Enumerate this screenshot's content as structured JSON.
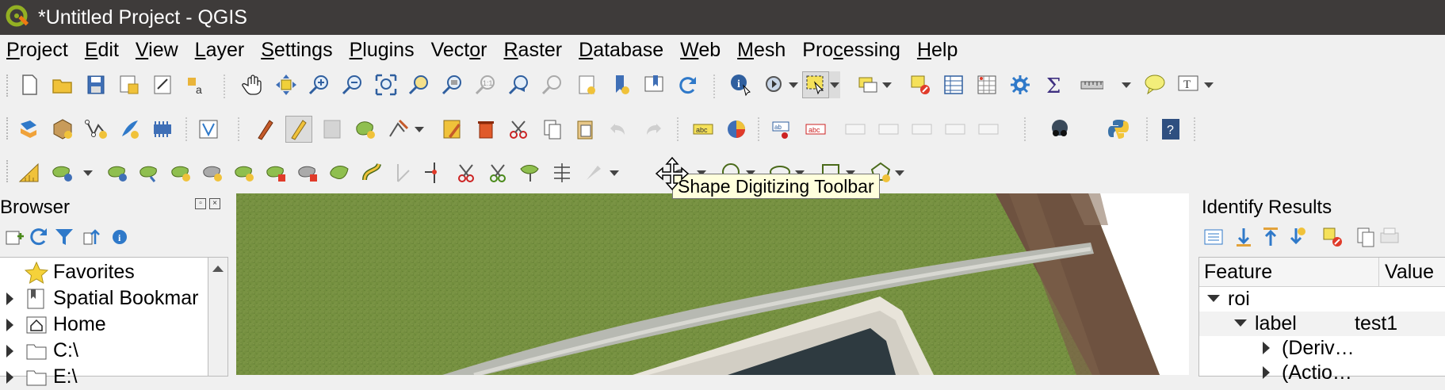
{
  "window": {
    "title": "*Untitled Project - QGIS",
    "logo_icon": "qgis-logo-icon"
  },
  "menubar": {
    "items": [
      {
        "label": "Project",
        "mnemonic": "P"
      },
      {
        "label": "Edit",
        "mnemonic": "E"
      },
      {
        "label": "View",
        "mnemonic": "V"
      },
      {
        "label": "Layer",
        "mnemonic": "L"
      },
      {
        "label": "Settings",
        "mnemonic": "S"
      },
      {
        "label": "Plugins",
        "mnemonic": "P"
      },
      {
        "label": "Vector",
        "mnemonic": "o"
      },
      {
        "label": "Raster",
        "mnemonic": "R"
      },
      {
        "label": "Database",
        "mnemonic": "D"
      },
      {
        "label": "Web",
        "mnemonic": "W"
      },
      {
        "label": "Mesh",
        "mnemonic": "M"
      },
      {
        "label": "Processing",
        "mnemonic": "c"
      },
      {
        "label": "Help",
        "mnemonic": "H"
      }
    ]
  },
  "toolbars": {
    "row1": [
      "new-project-icon",
      "open-project-icon",
      "save-project-icon",
      "save-as-icon",
      "print-layout-icon",
      "style-manager-icon",
      "pan-icon",
      "pan-to-selection-icon",
      "zoom-in-icon",
      "zoom-out-icon",
      "zoom-full-icon",
      "zoom-to-selection-icon",
      "zoom-to-layer-icon",
      "zoom-native-icon",
      "zoom-last-icon",
      "zoom-next-icon",
      "new-map-view-icon",
      "new-bookmark-icon",
      "show-bookmarks-icon",
      "refresh-icon",
      "identify-icon",
      "run-action-icon",
      "select-features-icon",
      "select-by-value-icon",
      "deselect-icon",
      "attribute-table-icon",
      "field-calculator-icon",
      "toolbox-icon",
      "statistics-icon",
      "measure-icon",
      "map-tips-icon",
      "text-annotation-icon"
    ],
    "row2": [
      "data-source-manager-icon",
      "new-geopackage-icon",
      "new-shapefile-icon",
      "new-spatialite-icon",
      "new-temporary-layer-icon",
      "new-virtual-layer-icon",
      "current-edits-icon",
      "toggle-editing-icon",
      "save-edits-icon",
      "add-polygon-icon",
      "vertex-tool-icon",
      "modify-attributes-icon",
      "delete-selected-icon",
      "cut-features-icon",
      "copy-features-icon",
      "paste-features-icon",
      "undo-icon",
      "redo-icon",
      "label-toolbar-icon",
      "diagram-icon",
      "pin-label-icon",
      "show-hide-labels-icon",
      "python-console-icon",
      "help-icon"
    ],
    "row3": [
      "snapping-icon",
      "advanced-digitizing-icon",
      "polygon-tools-icon"
    ]
  },
  "tooltip": {
    "text": "Shape Digitizing Toolbar"
  },
  "browser": {
    "title": "Browser",
    "items": [
      {
        "label": "Favorites",
        "icon": "star-icon",
        "expandable": false
      },
      {
        "label": "Spatial Bookmar",
        "icon": "bookmark-icon",
        "expandable": true
      },
      {
        "label": "Home",
        "icon": "home-icon",
        "expandable": true
      },
      {
        "label": "C:\\",
        "icon": "folder-icon",
        "expandable": true
      },
      {
        "label": "E:\\",
        "icon": "folder-icon",
        "expandable": true
      }
    ]
  },
  "identify": {
    "title": "Identify Results",
    "columns": [
      "Feature",
      "Value"
    ],
    "rows": [
      {
        "label": "roi",
        "value": "",
        "level": 0,
        "state": "expanded"
      },
      {
        "label": "label",
        "value": "test1",
        "level": 1,
        "state": "expanded"
      },
      {
        "label": "(Deriv…",
        "value": "",
        "level": 2,
        "state": "collapsed"
      },
      {
        "label": "(Actio…",
        "value": "",
        "level": 2,
        "state": "collapsed"
      }
    ]
  },
  "colors": {
    "titlebar": "#3e3b3a",
    "grass": "#6e8a3c",
    "soil": "#7a5a44"
  }
}
